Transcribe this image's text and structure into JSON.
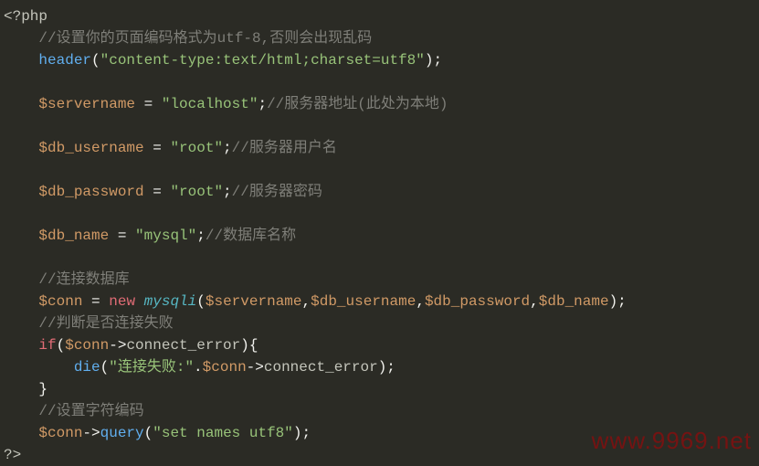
{
  "code": {
    "l1": {
      "a": "<?php"
    },
    "l2": {
      "a": "//设置你的页面编码格式为utf-8,否则会出现乱码"
    },
    "l3": {
      "a": "header",
      "b": "(",
      "c": "\"content-type:text/html;charset=utf8\"",
      "d": ");"
    },
    "l5": {
      "a": "$servername",
      "b": " = ",
      "c": "\"localhost\"",
      "d": ";",
      "e": "//服务器地址(此处为本地)"
    },
    "l7": {
      "a": "$db_username",
      "b": " = ",
      "c": "\"root\"",
      "d": ";",
      "e": "//服务器用户名"
    },
    "l9": {
      "a": "$db_password",
      "b": " = ",
      "c": "\"root\"",
      "d": ";",
      "e": "//服务器密码"
    },
    "l11": {
      "a": "$db_name",
      "b": " = ",
      "c": "\"mysql\"",
      "d": ";",
      "e": "//数据库名称"
    },
    "l13": {
      "a": "//连接数据库"
    },
    "l14": {
      "a": "$conn",
      "b": " = ",
      "c": "new",
      "d": " ",
      "e": "mysqli",
      "f": "(",
      "g": "$servername",
      "h": ",",
      "i": "$db_username",
      "j": ",",
      "k": "$db_password",
      "l": ",",
      "m": "$db_name",
      "n": ");"
    },
    "l15": {
      "a": "//判断是否连接失败"
    },
    "l16": {
      "a": "if",
      "b": "(",
      "c": "$conn",
      "d": "->",
      "e": "connect_error",
      "f": "){"
    },
    "l17": {
      "a": "die",
      "b": "(",
      "c": "\"连接失败:\"",
      "d": ".",
      "e": "$conn",
      "f": "->",
      "g": "connect_error",
      "h": ");"
    },
    "l18": {
      "a": "}"
    },
    "l19": {
      "a": "//设置字符编码"
    },
    "l20": {
      "a": "$conn",
      "b": "->",
      "c": "query",
      "d": "(",
      "e": "\"set names utf8\"",
      "f": ");"
    },
    "l21": {
      "a": "?>"
    }
  },
  "watermark": "www.9969.net"
}
